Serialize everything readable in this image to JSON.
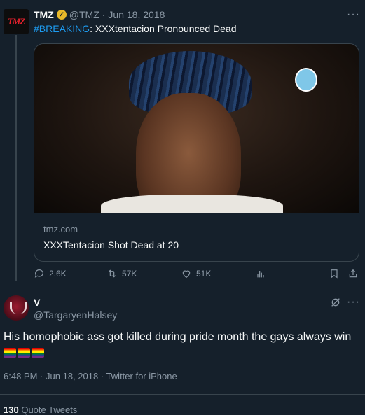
{
  "parent_tweet": {
    "author_name": "TMZ",
    "avatar_text": "TMZ",
    "handle": "@TMZ",
    "separator": "·",
    "date": "Jun 18, 2018",
    "hashtag": "#BREAKING",
    "text": ": XXXtentacion Pronounced Dead",
    "more_label": "···",
    "card": {
      "domain": "tmz.com",
      "title": "XXXTentacion Shot Dead at 20"
    },
    "actions": {
      "replies": "2.6K",
      "retweets": "57K",
      "likes": "51K"
    }
  },
  "tweet": {
    "author_name": "V",
    "handle": "@TargaryenHalsey",
    "more_label": "···",
    "text": "His homophobic ass got killed during pride month the gays always win",
    "emoji": [
      "rainbow-flag",
      "rainbow-flag",
      "rainbow-flag"
    ],
    "time": "6:48 PM",
    "date": "Jun 18, 2018",
    "source": "Twitter for iPhone",
    "meta_separator": "·",
    "stats_count": "130",
    "stats_label": "Quote Tweets"
  },
  "colors": {
    "background": "#15202b",
    "text": "#f7f9f9",
    "secondary": "#8b98a5",
    "accent": "#1d9bf0",
    "verified": "#e8b829"
  }
}
